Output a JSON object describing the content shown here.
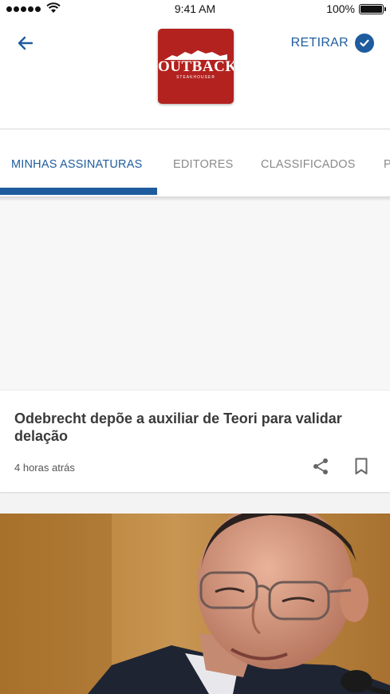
{
  "status_bar": {
    "time": "9:41 AM",
    "battery": "100%"
  },
  "header": {
    "logo": {
      "wordmark": "OUTBACK",
      "subtitle": "STEAKHOUSE®",
      "color": "#b3221f"
    },
    "action_label": "RETIRAR",
    "accent": "#1e5c9e"
  },
  "tabs": [
    {
      "label": "MINHAS ASSINATURAS",
      "active": true
    },
    {
      "label": "EDITORES",
      "active": false
    },
    {
      "label": "CLASSIFICADOS",
      "active": false
    },
    {
      "label": "P",
      "active": false
    }
  ],
  "feed": {
    "cards": [
      {
        "title": "Odebrecht depõe a auxiliar de Teori para validar delação",
        "time": "4 horas atrás",
        "actions": [
          "share-icon",
          "bookmark-icon"
        ]
      },
      {
        "image": "man-with-glasses-portrait-photo"
      }
    ]
  }
}
